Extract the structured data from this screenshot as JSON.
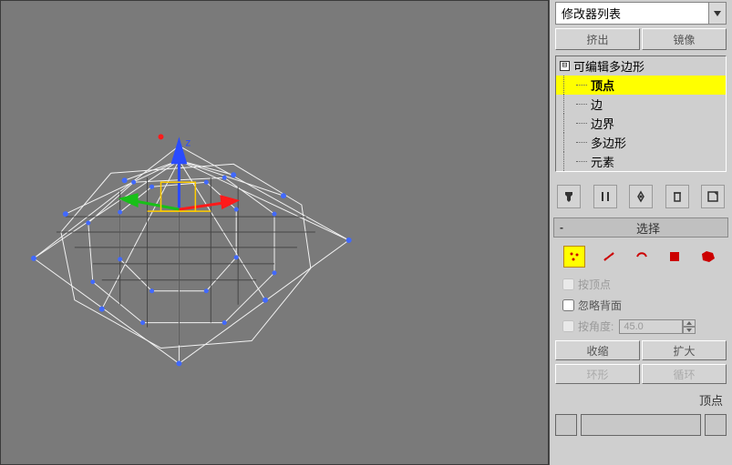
{
  "dropdown": {
    "label": "修改器列表"
  },
  "topButtons": {
    "extrude": "挤出",
    "mirror": "镜像"
  },
  "stack": {
    "root": "可编辑多边形",
    "items": [
      "顶点",
      "边",
      "边界",
      "多边形",
      "元素"
    ],
    "activeIndex": 0
  },
  "rollup": {
    "title": "选择"
  },
  "checkboxes": {
    "byVertex": "按顶点",
    "ignoreBack": "忽略背面",
    "byAngle": "按角度:"
  },
  "angle": {
    "value": "45.0"
  },
  "ringLoop": {
    "shrink": "收缩",
    "grow": "扩大",
    "ring": "环形",
    "loop": "循环"
  },
  "hint": "顶点",
  "gizmo": {
    "axisZ": "z"
  }
}
